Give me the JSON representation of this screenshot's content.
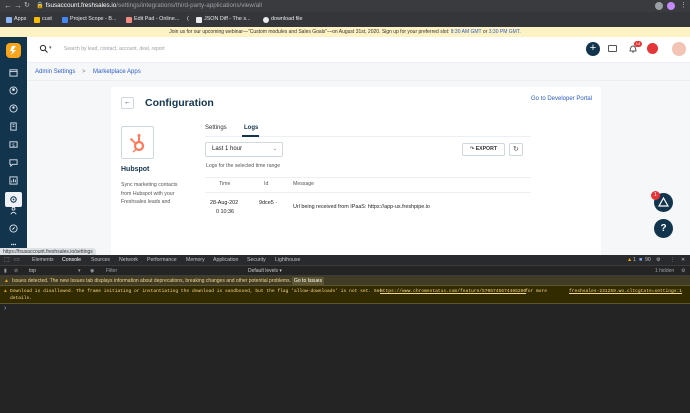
{
  "browser": {
    "url_host": "fsusaccount.freshsales.io",
    "url_path": "/settings/integrations/third-party-applications/view/all",
    "bookmarks": [
      {
        "label": "Apps"
      },
      {
        "label": "cust"
      },
      {
        "label": "Project Scope - B..."
      },
      {
        "label": "Edit Pad - Online..."
      },
      {
        "label": "("
      },
      {
        "label": "JSON Diff - The s..."
      },
      {
        "label": "download file"
      }
    ],
    "status_url": "https://fsusaccount.freshsales.io/settings"
  },
  "banner": {
    "text": "Join us for our upcoming webinar—\"Custom modules and Sales Goals\"—on August 31st, 2020. Sign up for your preferred slot:",
    "slot1": "8:30 AM GMT",
    "or": "or",
    "slot2": "3:30 PM GMT."
  },
  "topbar": {
    "search_placeholder": "Search by lead, contact, account, deal, report",
    "notification_count": "14"
  },
  "breadcrumb": {
    "admin": "Admin Settings",
    "separator": ">",
    "current": "Marketplace Apps"
  },
  "page": {
    "title": "Configuration",
    "developer_portal": "Go to Developer Portal"
  },
  "app": {
    "name": "Hubspot",
    "description_lines": [
      "Sync marketing contacts",
      "from Hubspot with your",
      "Freshsales leads and"
    ]
  },
  "tabs": [
    {
      "label": "Settings"
    },
    {
      "label": "Logs"
    }
  ],
  "logs": {
    "time_filter": "Last 1 hour",
    "caption": "Logs for the selected time range",
    "export_label": "EXPORT",
    "columns": [
      "Time",
      "Id",
      "Message"
    ],
    "rows": [
      {
        "time_line1": "28-Aug-202",
        "time_line2": "0 10:36",
        "id": "9dce5 ·",
        "message": "Url being received from IPaaS: https://app-us.freshpipe.io"
      }
    ]
  },
  "fab": {
    "badge": "1",
    "help": "?"
  },
  "devtools": {
    "tabs": [
      "Elements",
      "Console",
      "Sources",
      "Network",
      "Performance",
      "Memory",
      "Application",
      "Security",
      "Lighthouse"
    ],
    "active_tab": "Console",
    "warn_count": "1",
    "info_count": "90",
    "context": "top",
    "filter_placeholder": "Filter",
    "levels": "Default levels ▾",
    "hidden": "1 hidden",
    "issue_text": "Issues detected. The new Issues tab displays information about deprecations, breaking changes and other potential problems.",
    "issue_button": "Go to Issues",
    "warning_text": "Download is disallowed. The frame initiating or instantiating the download is sandboxed, but the flag 'allow-downloads' is not set. See",
    "warning_link": "https://www.chromestatus.com/feature/5706745674465280",
    "warning_more": "for more",
    "warning_details": "details.",
    "warning_source": "freshsales-231259.wo.cltcgtate=settings:1",
    "prompt": "›"
  },
  "colors": {
    "sidebar": "#12344d",
    "link": "#2c5cc5",
    "fab": "#12344d",
    "badge": "#e43538",
    "hubspot": "#ff7a59"
  }
}
